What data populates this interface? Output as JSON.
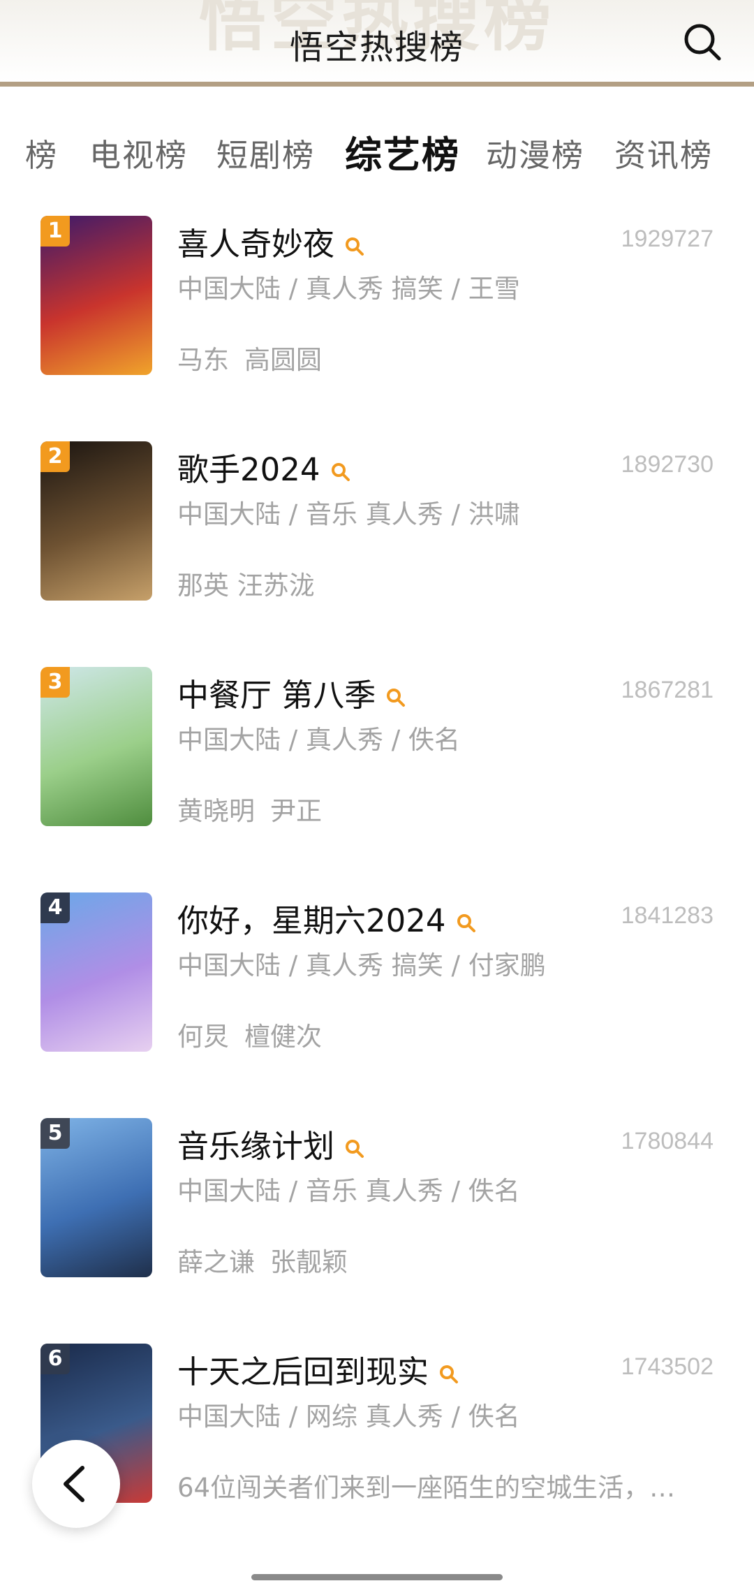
{
  "header": {
    "watermark": "悟空热搜榜",
    "title": "悟空热搜榜"
  },
  "tabs": [
    {
      "label": "榜",
      "active": false
    },
    {
      "label": "电视榜",
      "active": false
    },
    {
      "label": "短剧榜",
      "active": false
    },
    {
      "label": "综艺榜",
      "active": true
    },
    {
      "label": "动漫榜",
      "active": false
    },
    {
      "label": "资讯榜",
      "active": false
    }
  ],
  "items": [
    {
      "rank": "1",
      "title": "喜人奇妙夜",
      "score": "1929727",
      "meta": "中国大陆 / 真人秀 搞笑 / 王雪",
      "cast": [
        "马东",
        "高圆圆"
      ],
      "badge_color": "#f29a1f",
      "poster_colors": [
        "#3b1a6b",
        "#c9342d",
        "#f0a42b"
      ]
    },
    {
      "rank": "2",
      "title": "歌手2024",
      "score": "1892730",
      "meta": "中国大陆 / 音乐 真人秀 / 洪啸",
      "cast": [
        "那英 汪苏泷"
      ],
      "badge_color": "#f29a1f",
      "poster_colors": [
        "#1a1410",
        "#6e5232",
        "#c6a06a"
      ]
    },
    {
      "rank": "3",
      "title": "中餐厅 第八季",
      "score": "1867281",
      "meta": "中国大陆 / 真人秀 / 佚名",
      "cast": [
        "黄晓明",
        "尹正"
      ],
      "badge_color": "#f29a1f",
      "poster_colors": [
        "#cfe7ea",
        "#9bcf8a",
        "#4f8d3e"
      ]
    },
    {
      "rank": "4",
      "title": "你好，星期六2024",
      "score": "1841283",
      "meta": "中国大陆 / 真人秀 搞笑 / 付家鹏",
      "cast": [
        "何炅",
        "檀健次"
      ],
      "badge_color": "#2f3a4f",
      "poster_colors": [
        "#6aa8e8",
        "#b08ee6",
        "#e7d0f0"
      ]
    },
    {
      "rank": "5",
      "title": "音乐缘计划",
      "score": "1780844",
      "meta": "中国大陆 / 音乐 真人秀 / 佚名",
      "cast": [
        "薛之谦",
        "张靓颖"
      ],
      "badge_color": "#3f4756",
      "poster_colors": [
        "#7fb3e6",
        "#3e6fb3",
        "#1f2f4a"
      ]
    },
    {
      "rank": "6",
      "title": "十天之后回到现实",
      "score": "1743502",
      "meta": "中国大陆 / 网综 真人秀 / 佚名",
      "cast": [
        "64位闯关者们来到一座陌生的空城生活，…"
      ],
      "badge_color": "#2f3a4f",
      "poster_colors": [
        "#1a2a4a",
        "#3a5a8a",
        "#c93a36"
      ]
    }
  ],
  "icons": {
    "search": "search-icon",
    "hot": "hot-search-icon",
    "back": "chevron-left-icon"
  },
  "colors": {
    "accent": "#f29a1f",
    "header_border": "#b39f84"
  }
}
